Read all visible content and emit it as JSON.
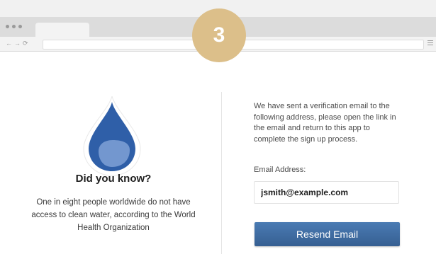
{
  "step": {
    "number": "3",
    "color": "#dcbf8a"
  },
  "browser": {
    "nav_back": "←",
    "nav_forward": "→",
    "nav_reload": "⟳",
    "icons": [
      "window-dot-icon",
      "back-arrow-icon",
      "forward-arrow-icon",
      "reload-icon",
      "menu-icon"
    ]
  },
  "fact": {
    "icon": "water-drop-icon",
    "title": "Did you know?",
    "text": "One in eight people worldwide do not have access to clean water, according to the World Health Organization"
  },
  "verification": {
    "message": "We have sent a verification email to the following address, please open the link in the email and return to this app to complete the sign up process.",
    "email_label": "Email Address:",
    "email_value": "jsmith@example.com",
    "resend_label": "Resend Email"
  },
  "colors": {
    "drop": "#2f5fa8",
    "button": "#3f6fa6"
  }
}
